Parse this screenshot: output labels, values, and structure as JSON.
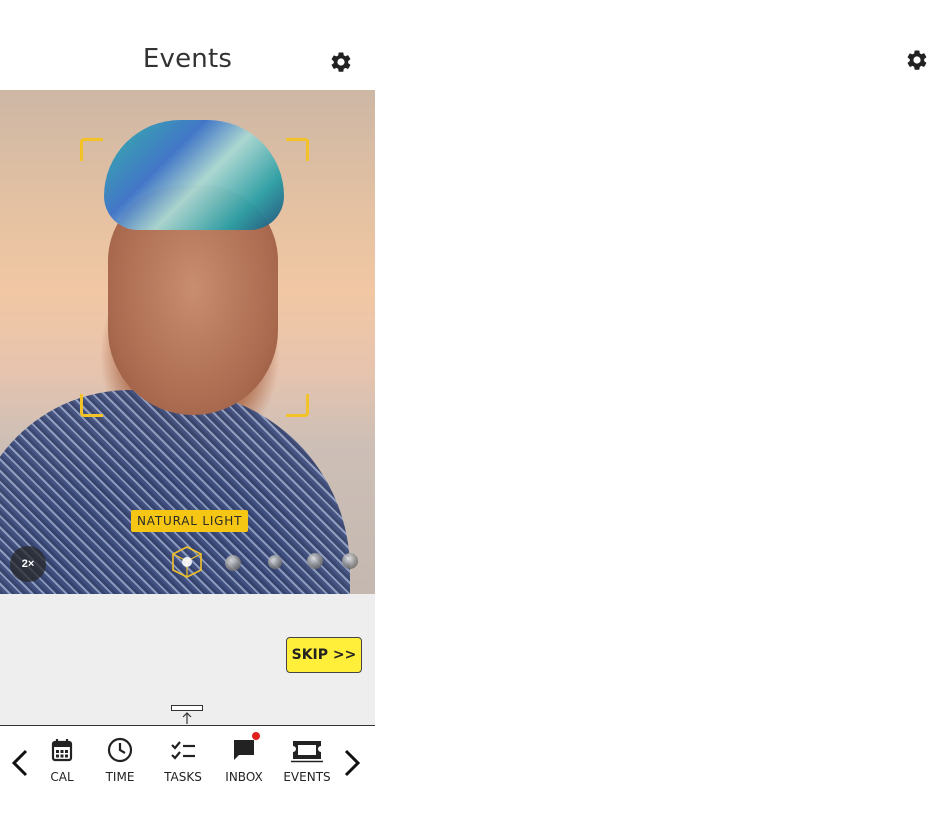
{
  "header": {
    "title": "Events"
  },
  "camera": {
    "light_mode_label": "NATURAL LIGHT",
    "zoom_label": "2×",
    "light_modes_count": 5,
    "accent_color": "#f5c714"
  },
  "actions": {
    "skip_label": "SKIP >>"
  },
  "nav": {
    "items": [
      {
        "label": "CAL",
        "icon": "calendar-icon"
      },
      {
        "label": "TIME",
        "icon": "clock-icon"
      },
      {
        "label": "TASKS",
        "icon": "tasks-icon"
      },
      {
        "label": "INBOX",
        "icon": "chat-icon",
        "badge": true
      },
      {
        "label": "EVENTS",
        "icon": "ticket-icon"
      }
    ],
    "badge_color": "#e0201a"
  }
}
